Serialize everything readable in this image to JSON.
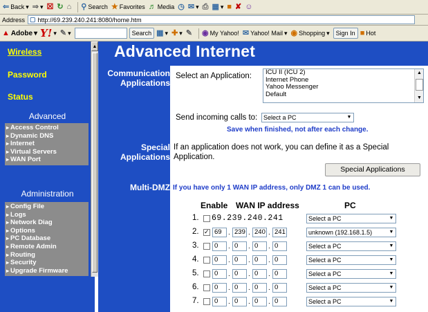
{
  "browser": {
    "back_label": "Back",
    "search_label": "Search",
    "favorites_label": "Favorites",
    "media_label": "Media",
    "address_label": "Address",
    "address_url": "http://69.239.240.241:8080/home.htm",
    "adobe_label": "Adobe",
    "yahoo_label": "Y!",
    "search_button": "Search",
    "my_yahoo": "My Yahoo!",
    "yahoo_mail": "Yahoo! Mail",
    "shopping": "Shopping",
    "sign_in": "Sign In",
    "hot": "Hot"
  },
  "sidebar": {
    "top_links": [
      "Wireless",
      "Password",
      "Status"
    ],
    "advanced_heading": "Advanced",
    "advanced_items": [
      "Access Control",
      "Dynamic DNS",
      "Internet",
      "Virtual Servers",
      "WAN Port"
    ],
    "admin_heading": "Administration",
    "admin_items": [
      "Config File",
      "Logs",
      "Network Diag",
      "Options",
      "PC Database",
      "Remote Admin",
      "Routing",
      "Security",
      "Upgrade Firmware"
    ]
  },
  "page": {
    "title": "Advanced Internet",
    "comm_label": "Communication\nApplications",
    "select_app_label": "Select an Application:",
    "applications": [
      "ICU II (ICU 2)",
      "Internet Phone",
      "Yahoo Messenger",
      "Default"
    ],
    "send_calls_label": "Send incoming calls to:",
    "send_calls_value": "Select a PC",
    "save_note": "Save when finished, not after each change.",
    "special_label": "Special\nApplications",
    "special_text": "If an application does not work, you can define it as a Special\nApplication.",
    "special_button": "Special Applications",
    "multidmz_label": "Multi-DMZ",
    "multidmz_note": "If you have only 1 WAN IP address, only DMZ 1 can be used.",
    "col_enable": "Enable",
    "col_wan": "WAN IP address",
    "col_pc": "PC",
    "dmz_rows": [
      {
        "num": "1.",
        "checked": false,
        "ip_static": "69.239.240.241",
        "ip": null,
        "pc": "Select a PC"
      },
      {
        "num": "2.",
        "checked": true,
        "ip_static": null,
        "ip": [
          "69",
          "239",
          "240",
          "241"
        ],
        "pc": "unknown (192.168.1.5)"
      },
      {
        "num": "3.",
        "checked": false,
        "ip_static": null,
        "ip": [
          "0",
          "0",
          "0",
          "0"
        ],
        "pc": "Select a PC"
      },
      {
        "num": "4.",
        "checked": false,
        "ip_static": null,
        "ip": [
          "0",
          "0",
          "0",
          "0"
        ],
        "pc": "Select a PC"
      },
      {
        "num": "5.",
        "checked": false,
        "ip_static": null,
        "ip": [
          "0",
          "0",
          "0",
          "0"
        ],
        "pc": "Select a PC"
      },
      {
        "num": "6.",
        "checked": false,
        "ip_static": null,
        "ip": [
          "0",
          "0",
          "0",
          "0"
        ],
        "pc": "Select a PC"
      },
      {
        "num": "7.",
        "checked": false,
        "ip_static": null,
        "ip": [
          "0",
          "0",
          "0",
          "0"
        ],
        "pc": "Select a PC"
      }
    ]
  },
  "colors": {
    "nav_blue": "#1e4ec3",
    "link_yellow": "#ffff00",
    "menu_gray": "#8c8c8c",
    "note_blue": "#1e3cc8"
  }
}
